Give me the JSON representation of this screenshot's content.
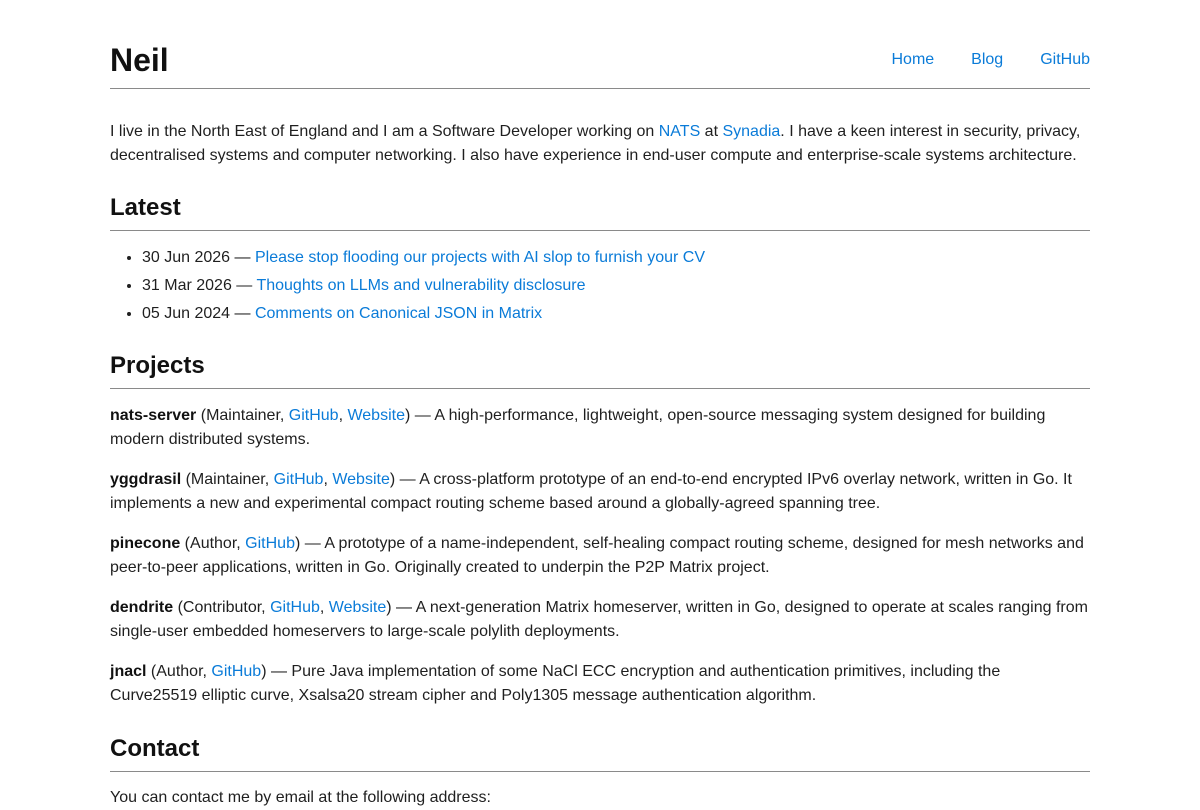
{
  "site": {
    "title": "Neil",
    "nav": [
      "Home",
      "Blog",
      "GitHub"
    ]
  },
  "intro": {
    "part1": "I live in the North East of England and I am a Software Developer working on ",
    "link_nats": "NATS",
    "part2": " at ",
    "link_synadia": "Synadia",
    "part3": ". I have a keen interest in security, privacy, decentralised systems and computer networking. I also have experience in end-user compute and enterprise-scale systems architecture."
  },
  "latest": {
    "heading": "Latest",
    "posts": [
      {
        "date": "30 Jun 2026",
        "title": "Please stop flooding our projects with AI slop to furnish your CV"
      },
      {
        "date": "31 Mar 2026",
        "title": "Thoughts on LLMs and vulnerability disclosure"
      },
      {
        "date": "05 Jun 2024",
        "title": "Comments on Canonical JSON in Matrix"
      }
    ],
    "separator": " — "
  },
  "projects": {
    "heading": "Projects",
    "items": [
      {
        "name": "nats-server",
        "role": "Maintainer",
        "github": "GitHub",
        "website": "Website",
        "description": "A high-performance, lightweight, open-source messaging system designed for building modern distributed systems."
      },
      {
        "name": "yggdrasil",
        "role": "Maintainer",
        "github": "GitHub",
        "website": "Website",
        "description": "A cross-platform prototype of an end-to-end encrypted IPv6 overlay network, written in Go. It implements a new and experimental compact routing scheme based around a globally-agreed spanning tree."
      },
      {
        "name": "pinecone",
        "role": "Author",
        "github": "GitHub",
        "website": "",
        "description": "A prototype of a name-independent, self-healing compact routing scheme, designed for mesh networks and peer-to-peer applications, written in Go. Originally created to underpin the P2P Matrix project."
      },
      {
        "name": "dendrite",
        "role": "Contributor",
        "github": "GitHub",
        "website": "Website",
        "description": "A next-generation Matrix homeserver, written in Go, designed to operate at scales ranging from single-user embedded homeservers to large-scale polylith deployments."
      },
      {
        "name": "jnacl",
        "role": "Author",
        "github": "GitHub",
        "website": "",
        "description": "Pure Java implementation of some NaCl ECC encryption and authentication primitives, including the Curve25519 elliptic curve, Xsalsa20 stream cipher and Poly1305 message authentication algorithm."
      }
    ]
  },
  "contact": {
    "heading": "Contact",
    "text": "You can contact me by email at the following address:"
  },
  "colors": {
    "link": "#0a7bd8",
    "text": "#1f1f1f",
    "rule": "#8a8a8a"
  }
}
